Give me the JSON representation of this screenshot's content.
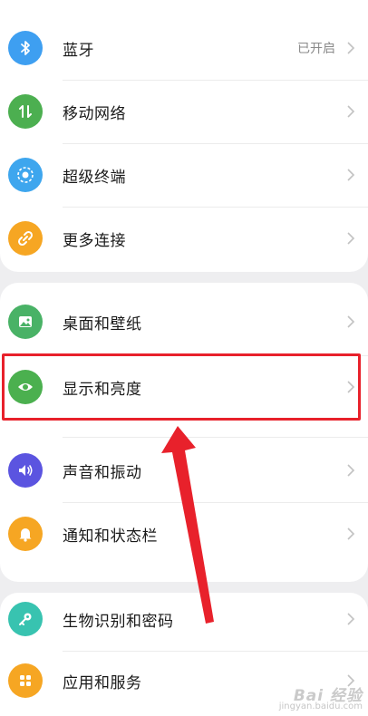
{
  "settings": {
    "items": [
      {
        "label": "蓝牙",
        "value": "已开启",
        "icon": "bluetooth-icon",
        "color": "#3e9ff1"
      },
      {
        "label": "移动网络",
        "icon": "mobile-data-icon",
        "color": "#4caf50"
      },
      {
        "label": "超级终端",
        "icon": "super-device-icon",
        "color": "#3ea6ee"
      },
      {
        "label": "更多连接",
        "icon": "link-icon",
        "color": "#f6a623"
      },
      {
        "label": "桌面和壁纸",
        "icon": "wallpaper-icon",
        "color": "#49b266"
      },
      {
        "label": "显示和亮度",
        "icon": "eye-icon",
        "color": "#4bb04f"
      },
      {
        "label": "声音和振动",
        "icon": "speaker-icon",
        "color": "#5b54e0"
      },
      {
        "label": "通知和状态栏",
        "icon": "bell-icon",
        "color": "#f6a623"
      },
      {
        "label": "生物识别和密码",
        "icon": "key-icon",
        "color": "#38c3b0"
      },
      {
        "label": "应用和服务",
        "icon": "apps-icon",
        "color": "#f6a623"
      }
    ]
  },
  "annotation": {
    "highlight_color": "#e8212b"
  },
  "watermark": {
    "brand": "Bai 经验",
    "url": "jingyan.baidu.com"
  }
}
